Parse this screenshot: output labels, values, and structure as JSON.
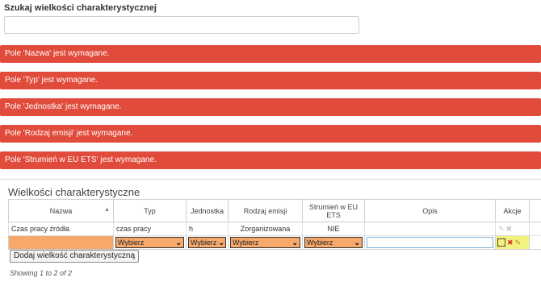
{
  "search": {
    "label": "Szukaj wielkości charakterystycznej",
    "value": ""
  },
  "alerts": [
    "Pole 'Nazwa' jest wymagane.",
    "Pole 'Typ' jest wymagane.",
    "Pole 'Jednostka' jest wymagane.",
    "Pole 'Rodzaj emisji' jest wymagane.",
    "Pole 'Strumień w EU ETS' jest wymagane."
  ],
  "panel": {
    "title": "Wielkości charakterystyczne",
    "columns": [
      "Nazwa",
      "Typ",
      "Jednostka",
      "Rodzaj emisji",
      "Strumień w EU ETS",
      "Opis",
      "Akcje"
    ],
    "row": {
      "nazwa": "Czas pracy źródła",
      "typ": "czas pracy",
      "jednostka": "h",
      "rodzaj": "Zorganizowana",
      "strumien": "NIE",
      "opis": ""
    },
    "edit_row": {
      "typ": "Wybierz",
      "jednostka": "Wybierz",
      "rodzaj": "Wybierz",
      "strumien": "Wybierz"
    },
    "add_button": "Dodaj wielkość charakterystyczną",
    "showing": "Showing 1 to 2 of 2"
  },
  "colors": {
    "alert_bg": "#e14b3b",
    "required_bg": "#f7a96b",
    "action_bg": "#f3f27e"
  }
}
